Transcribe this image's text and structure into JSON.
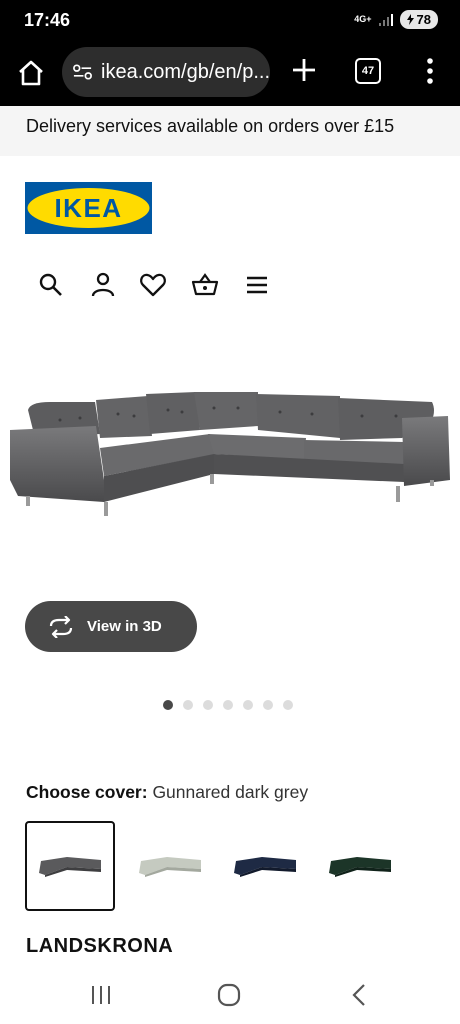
{
  "status_bar": {
    "time": "17:46",
    "network": "4G+",
    "battery": "78"
  },
  "browser": {
    "url": "ikea.com/gb/en/p...",
    "tab_count": "47"
  },
  "banner": {
    "text": "Delivery services available on orders over £15"
  },
  "brand": {
    "logo_text": "IKEA",
    "logo_colors": {
      "blue": "#0058a3",
      "yellow": "#ffdb00"
    }
  },
  "header_icons": [
    "search-icon",
    "account-icon",
    "favourites-icon",
    "basket-icon",
    "menu-icon"
  ],
  "gallery": {
    "view3d_label": "View in 3D",
    "image_count": 7,
    "active_index": 0
  },
  "cover": {
    "label": "Choose cover:",
    "value": "Gunnared dark grey",
    "options": [
      {
        "name": "Gunnared dark grey",
        "color": "#5a5a5c",
        "selected": true
      },
      {
        "name": "light green",
        "color": "#c5cac0",
        "selected": false
      },
      {
        "name": "dark blue",
        "color": "#1e2a44",
        "selected": false
      },
      {
        "name": "dark green",
        "color": "#1c3528",
        "selected": false
      }
    ]
  },
  "product": {
    "name": "LANDSKRONA"
  }
}
